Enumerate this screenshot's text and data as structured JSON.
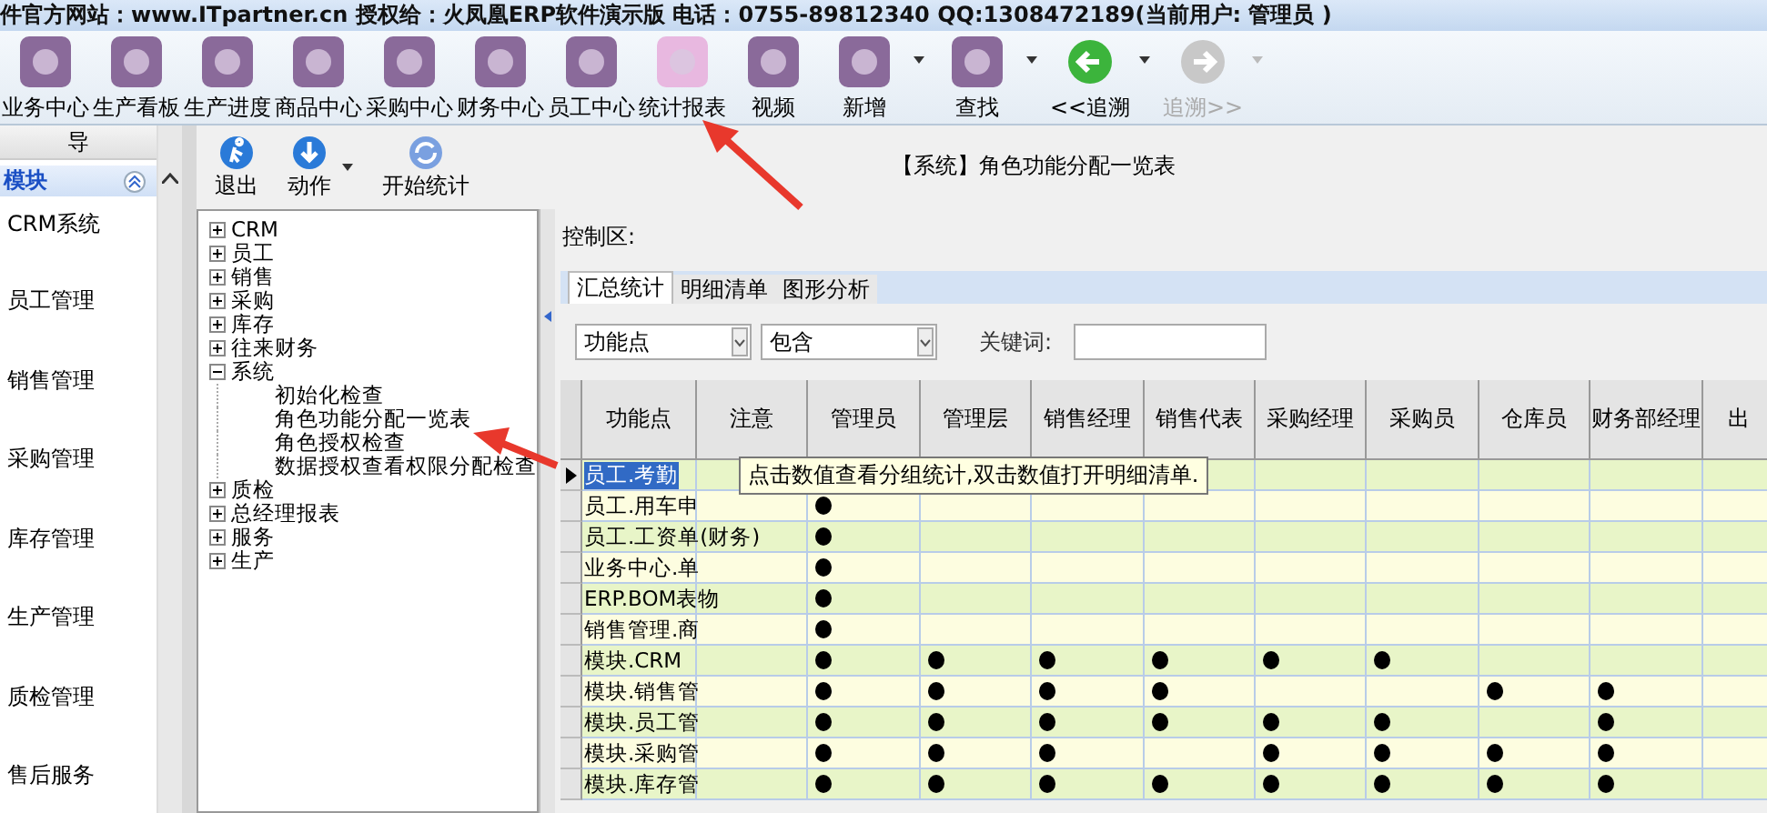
{
  "title_bar": {
    "text": "件官方网站：www.ITpartner.cn  授权给：火凤凰ERP软件演示版 电话：0755-89812340 QQ:1308472189(当前用户: 管理员 )"
  },
  "toolbar": [
    {
      "label": "业务中心",
      "dropdown": false,
      "disabled": false
    },
    {
      "label": "生产看板",
      "dropdown": false,
      "disabled": false
    },
    {
      "label": "生产进度",
      "dropdown": false,
      "disabled": false
    },
    {
      "label": "商品中心",
      "dropdown": false,
      "disabled": false
    },
    {
      "label": "采购中心",
      "dropdown": false,
      "disabled": false
    },
    {
      "label": "财务中心",
      "dropdown": false,
      "disabled": false
    },
    {
      "label": "员工中心",
      "dropdown": false,
      "disabled": false
    },
    {
      "label": "统计报表",
      "dropdown": false,
      "disabled": false
    },
    {
      "label": "视频",
      "dropdown": false,
      "disabled": false
    },
    {
      "label": "新增",
      "dropdown": true,
      "disabled": false
    },
    {
      "label": "查找",
      "dropdown": true,
      "disabled": false
    },
    {
      "label": "<<追溯",
      "dropdown": true,
      "disabled": false
    },
    {
      "label": "追溯>>",
      "dropdown": true,
      "disabled": true
    }
  ],
  "nav": {
    "header": "导",
    "section": "模块",
    "items": [
      {
        "label": "CRM系统"
      },
      {
        "label": "员工管理"
      },
      {
        "label": "销售管理"
      },
      {
        "label": "采购管理"
      },
      {
        "label": "库存管理"
      },
      {
        "label": "生产管理"
      },
      {
        "label": "质检管理"
      },
      {
        "label": "售后服务"
      }
    ]
  },
  "actions": [
    {
      "label": "退出",
      "dropdown": false
    },
    {
      "label": "动作",
      "dropdown": true
    },
    {
      "label": "开始统计",
      "dropdown": false
    }
  ],
  "report_title": "【系统】角色功能分配一览表",
  "tree": [
    {
      "label": "CRM",
      "expanded": false,
      "selected": false
    },
    {
      "label": "员工",
      "expanded": false,
      "selected": false
    },
    {
      "label": "销售",
      "expanded": false,
      "selected": false
    },
    {
      "label": "采购",
      "expanded": false,
      "selected": false
    },
    {
      "label": "库存",
      "expanded": false,
      "selected": false
    },
    {
      "label": "往来财务",
      "expanded": false,
      "selected": false
    },
    {
      "label": "系统",
      "expanded": true,
      "selected": false,
      "children": [
        {
          "label": "初始化检查",
          "selected": false
        },
        {
          "label": "角色功能分配一览表",
          "selected": false
        },
        {
          "label": "角色授权检查",
          "selected": false
        },
        {
          "label": "数据授权查看权限分配检查",
          "selected": false
        }
      ]
    },
    {
      "label": "质检",
      "expanded": false,
      "selected": false
    },
    {
      "label": "总经理报表",
      "expanded": false,
      "selected": false
    },
    {
      "label": "服务",
      "expanded": false,
      "selected": false
    },
    {
      "label": "生产",
      "expanded": false,
      "selected": false
    }
  ],
  "control_label": "控制区:",
  "tabs": [
    {
      "label": "汇总统计",
      "selected": true
    },
    {
      "label": "明细清单",
      "selected": false
    },
    {
      "label": "图形分析",
      "selected": false
    }
  ],
  "filter": {
    "field": "功能点",
    "operator": "包含",
    "keyword_label": "关键词:"
  },
  "table": {
    "columns": [
      "功能点",
      "注意",
      "管理员",
      "管理层",
      "销售经理",
      "销售代表",
      "采购经理",
      "采购员",
      "仓库员",
      "财务部经理",
      "出"
    ],
    "rows": [
      {
        "name": "员工.考勤",
        "selected": true
      },
      {
        "name": "员工.用车申",
        "selected": false,
        "dots": [
          false,
          true,
          false,
          false,
          false,
          false,
          false,
          false,
          false,
          false
        ]
      },
      {
        "name": "员工.工资单(财务)",
        "selected": false,
        "dots": [
          false,
          true,
          false,
          false,
          false,
          false,
          false,
          false,
          false,
          false
        ]
      },
      {
        "name": "业务中心.单",
        "selected": false,
        "dots": [
          false,
          true,
          false,
          false,
          false,
          false,
          false,
          false,
          false,
          false
        ]
      },
      {
        "name": "ERP.BOM表物",
        "selected": false,
        "dots": [
          false,
          true,
          false,
          false,
          false,
          false,
          false,
          false,
          false,
          false
        ]
      },
      {
        "name": "销售管理.商",
        "selected": false,
        "dots": [
          false,
          true,
          false,
          false,
          false,
          false,
          false,
          false,
          false,
          false
        ]
      },
      {
        "name": "模块.CRM",
        "selected": false,
        "dots": [
          false,
          true,
          true,
          true,
          true,
          true,
          true,
          false,
          false,
          false
        ]
      },
      {
        "name": "模块.销售管",
        "selected": false,
        "dots": [
          false,
          true,
          true,
          true,
          true,
          false,
          false,
          true,
          true,
          false
        ]
      },
      {
        "name": "模块.员工管",
        "selected": false,
        "dots": [
          false,
          true,
          true,
          true,
          true,
          true,
          true,
          false,
          true,
          false
        ]
      },
      {
        "name": "模块.采购管",
        "selected": false,
        "dots": [
          false,
          true,
          true,
          true,
          false,
          true,
          true,
          true,
          true,
          false
        ]
      },
      {
        "name": "模块.库存管",
        "selected": false,
        "dots": [
          false,
          true,
          true,
          true,
          true,
          true,
          true,
          true,
          true,
          false
        ]
      }
    ]
  },
  "tooltip": "点击数值查看分组统计,双击数值打开明细清单."
}
